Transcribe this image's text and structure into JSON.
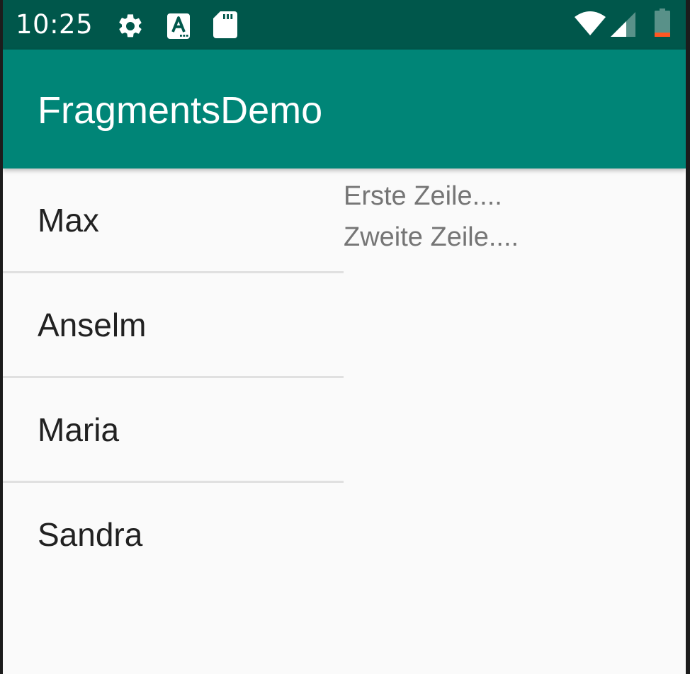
{
  "status_bar": {
    "time": "10:25",
    "icons": [
      "gear-icon",
      "a-icon",
      "sd-card-icon",
      "wifi-icon",
      "signal-icon",
      "battery-icon"
    ],
    "battery_level": 0.15
  },
  "app_bar": {
    "title": "FragmentsDemo"
  },
  "list": {
    "items": [
      {
        "label": "Max"
      },
      {
        "label": "Anselm"
      },
      {
        "label": "Maria"
      },
      {
        "label": "Sandra"
      }
    ]
  },
  "detail": {
    "lines": [
      "Erste Zeile....",
      "Zweite Zeile...."
    ]
  },
  "colors": {
    "status_bar": "#00574b",
    "app_bar": "#008577",
    "background": "#fafafa",
    "divider": "#e0e0e0",
    "battery_low": "#ff5722"
  }
}
